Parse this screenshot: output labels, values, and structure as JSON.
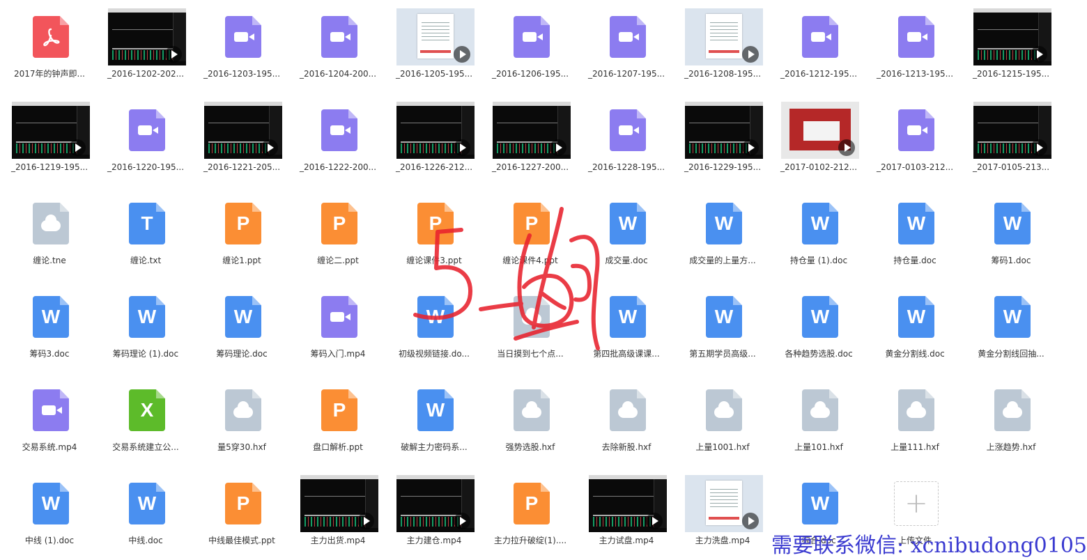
{
  "colors": {
    "pdf": "#f2555b",
    "video": "#8c7cf0",
    "ppt": "#fb8e34",
    "word": "#4a90f0",
    "excel": "#5dbb2a",
    "txt": "#4a90f0",
    "cloud": "#bcc8d4",
    "scribble": "#e8222d",
    "watermark": "#3a3ad0"
  },
  "files": [
    {
      "name": "2017年的钟声即...",
      "type": "pdf",
      "glyph": ""
    },
    {
      "name": "_2016-1202-202...",
      "type": "thumb-dark"
    },
    {
      "name": "_2016-1203-195...",
      "type": "video"
    },
    {
      "name": "_2016-1204-200...",
      "type": "video"
    },
    {
      "name": "_2016-1205-195...",
      "type": "thumb-light"
    },
    {
      "name": "_2016-1206-195...",
      "type": "video"
    },
    {
      "name": "_2016-1207-195...",
      "type": "video"
    },
    {
      "name": "_2016-1208-195...",
      "type": "thumb-light"
    },
    {
      "name": "_2016-1212-195...",
      "type": "video"
    },
    {
      "name": "_2016-1213-195...",
      "type": "video"
    },
    {
      "name": "_2016-1215-195...",
      "type": "thumb-dark"
    },
    {
      "name": "_2016-1219-195...",
      "type": "thumb-dark"
    },
    {
      "name": "_2016-1220-195...",
      "type": "video"
    },
    {
      "name": "_2016-1221-205...",
      "type": "thumb-dark"
    },
    {
      "name": "_2016-1222-200...",
      "type": "video"
    },
    {
      "name": "_2016-1226-212...",
      "type": "thumb-dark"
    },
    {
      "name": "_2016-1227-200...",
      "type": "thumb-dark"
    },
    {
      "name": "_2016-1228-195...",
      "type": "video"
    },
    {
      "name": "_2016-1229-195...",
      "type": "thumb-dark"
    },
    {
      "name": "_2017-0102-212...",
      "type": "thumb-red"
    },
    {
      "name": "_2017-0103-212...",
      "type": "video"
    },
    {
      "name": "_2017-0105-213...",
      "type": "thumb-dark"
    },
    {
      "name": "缠论.tne",
      "type": "cloud"
    },
    {
      "name": "缠论.txt",
      "type": "txt",
      "glyph": "T"
    },
    {
      "name": "缠论1.ppt",
      "type": "ppt",
      "glyph": "P"
    },
    {
      "name": "缠论二.ppt",
      "type": "ppt",
      "glyph": "P"
    },
    {
      "name": "缠论课件3.ppt",
      "type": "ppt",
      "glyph": "P"
    },
    {
      "name": "缠论课件4.ppt",
      "type": "ppt",
      "glyph": "P"
    },
    {
      "name": "成交量.doc",
      "type": "word",
      "glyph": "W"
    },
    {
      "name": "成交量的上量方...",
      "type": "word",
      "glyph": "W"
    },
    {
      "name": "持仓量 (1).doc",
      "type": "word",
      "glyph": "W"
    },
    {
      "name": "持仓量.doc",
      "type": "word",
      "glyph": "W"
    },
    {
      "name": "筹码1.doc",
      "type": "word",
      "glyph": "W"
    },
    {
      "name": "筹码3.doc",
      "type": "word",
      "glyph": "W"
    },
    {
      "name": "筹码理论 (1).doc",
      "type": "word",
      "glyph": "W"
    },
    {
      "name": "筹码理论.doc",
      "type": "word",
      "glyph": "W"
    },
    {
      "name": "筹码入门.mp4",
      "type": "video"
    },
    {
      "name": "初级视频链接.do...",
      "type": "word",
      "glyph": "W"
    },
    {
      "name": "当日摸到七个点...",
      "type": "cloud"
    },
    {
      "name": "第四批高级课课...",
      "type": "word",
      "glyph": "W"
    },
    {
      "name": "第五期学员高级...",
      "type": "word",
      "glyph": "W"
    },
    {
      "name": "各种趋势选股.doc",
      "type": "word",
      "glyph": "W"
    },
    {
      "name": "黄金分割线.doc",
      "type": "word",
      "glyph": "W"
    },
    {
      "name": "黄金分割线回抽...",
      "type": "word",
      "glyph": "W"
    },
    {
      "name": "交易系统.mp4",
      "type": "video"
    },
    {
      "name": "交易系统建立公...",
      "type": "excel",
      "glyph": "X"
    },
    {
      "name": "量5穿30.hxf",
      "type": "cloud"
    },
    {
      "name": "盘口解析.ppt",
      "type": "ppt",
      "glyph": "P"
    },
    {
      "name": "破解主力密码系...",
      "type": "word",
      "glyph": "W"
    },
    {
      "name": "强势选股.hxf",
      "type": "cloud"
    },
    {
      "name": "去除新股.hxf",
      "type": "cloud"
    },
    {
      "name": "上量1001.hxf",
      "type": "cloud"
    },
    {
      "name": "上量101.hxf",
      "type": "cloud"
    },
    {
      "name": "上量111.hxf",
      "type": "cloud"
    },
    {
      "name": "上涨趋势.hxf",
      "type": "cloud"
    },
    {
      "name": "中线 (1).doc",
      "type": "word",
      "glyph": "W"
    },
    {
      "name": "中线.doc",
      "type": "word",
      "glyph": "W"
    },
    {
      "name": "中线最佳模式.ppt",
      "type": "ppt",
      "glyph": "P"
    },
    {
      "name": "主力出货.mp4",
      "type": "thumb-dark"
    },
    {
      "name": "主力建仓.mp4",
      "type": "thumb-dark"
    },
    {
      "name": "主力拉升破绽(1)....",
      "type": "ppt",
      "glyph": "P"
    },
    {
      "name": "主力试盘.mp4",
      "type": "thumb-dark"
    },
    {
      "name": "主力洗盘.mp4",
      "type": "thumb-light"
    },
    {
      "name": "综合.doc",
      "type": "word",
      "glyph": "W"
    },
    {
      "name": "上传文件",
      "type": "upload",
      "glyph": "+"
    }
  ],
  "watermark": "需要联系微信: xcnibudong0105"
}
